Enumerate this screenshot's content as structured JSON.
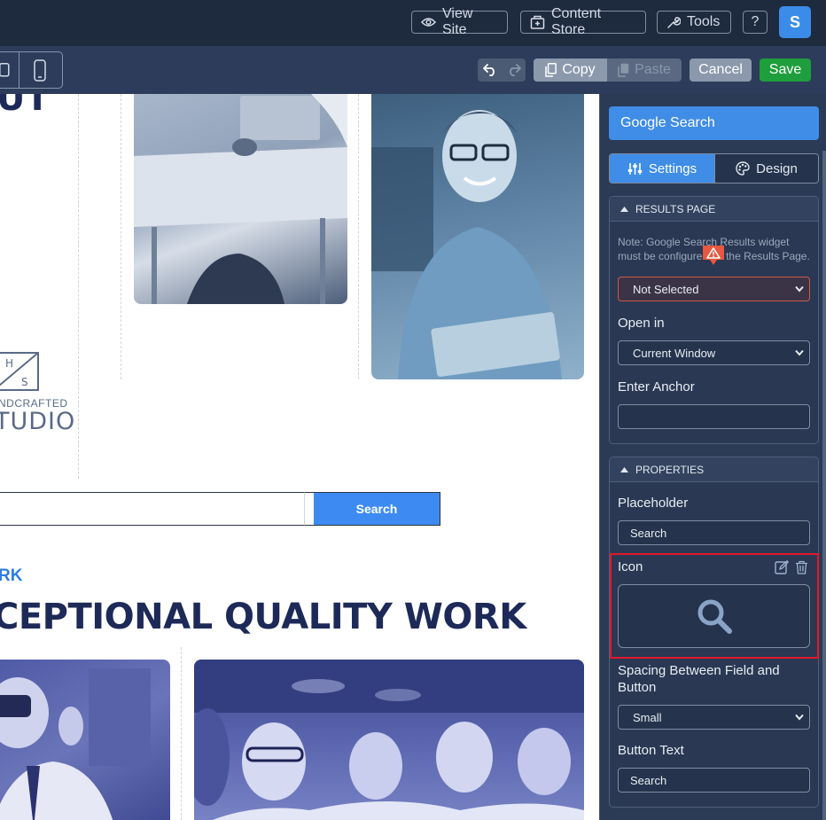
{
  "topbar": {
    "view_site": "View Site",
    "content_store": "Content Store",
    "tools": "Tools",
    "help": "?",
    "avatar_initial": "S"
  },
  "toolbar": {
    "copy": "Copy",
    "paste": "Paste",
    "cancel": "Cancel",
    "save": "Save"
  },
  "canvas": {
    "heading_fragment": "UT",
    "logo_top_left": "H",
    "logo_bottom_right": "S",
    "logo_line1": "NDCRAFTED",
    "logo_line2": "TUDIO",
    "search_button": "Search",
    "eyebrow": "RK",
    "big_heading": "CEPTIONAL QUALITY WORK"
  },
  "panel": {
    "widget_title": "Google Search",
    "tabs": [
      "Settings",
      "Design"
    ],
    "results_section": {
      "header": "RESULTS PAGE",
      "note": "Note: Google Search Results widget must be configured on the Results Page.",
      "results_page_value": "Not Selected",
      "open_in_label": "Open in",
      "open_in_value": "Current Window",
      "anchor_label": "Enter Anchor",
      "anchor_value": ""
    },
    "properties_section": {
      "header": "PROPERTIES",
      "placeholder_label": "Placeholder",
      "placeholder_value": "Search",
      "icon_label": "Icon",
      "icon_name": "search-icon",
      "spacing_label": "Spacing Between Field and Button",
      "spacing_value": "Small",
      "button_text_label": "Button Text",
      "button_text_value": "Search"
    }
  },
  "colors": {
    "accent_blue": "#3f8de6",
    "save_green": "#1f9e3d",
    "highlight_red": "#e0182c",
    "heading_navy": "#1d2a58"
  }
}
